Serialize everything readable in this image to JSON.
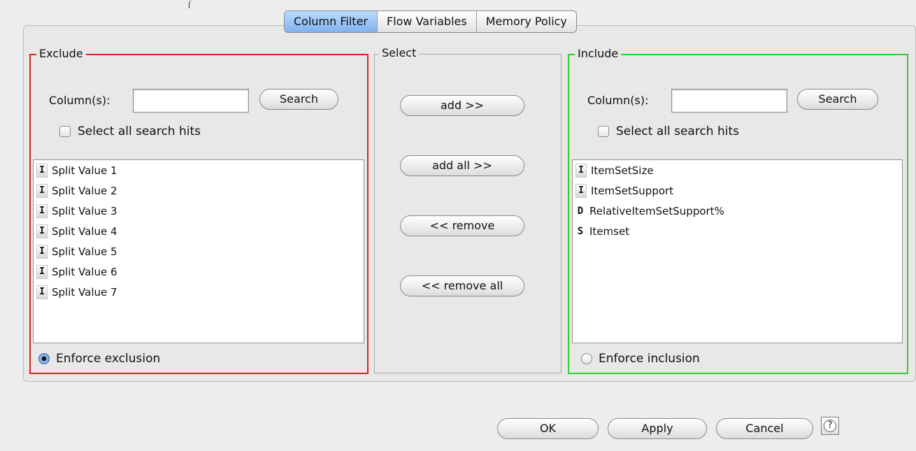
{
  "tabs": [
    {
      "label": "Column Filter",
      "active": true
    },
    {
      "label": "Flow Variables",
      "active": false
    },
    {
      "label": "Memory Policy",
      "active": false
    }
  ],
  "exclude": {
    "title": "Exclude",
    "columns_label": "Column(s):",
    "search_value": "",
    "search_button": "Search",
    "select_all_label": "Select all search hits",
    "select_all_checked": false,
    "items": [
      {
        "type": "I",
        "label": "Split Value 1"
      },
      {
        "type": "I",
        "label": "Split Value 2"
      },
      {
        "type": "I",
        "label": "Split Value 3"
      },
      {
        "type": "I",
        "label": "Split Value 4"
      },
      {
        "type": "I",
        "label": "Split Value 5"
      },
      {
        "type": "I",
        "label": "Split Value 6"
      },
      {
        "type": "I",
        "label": "Split Value 7"
      }
    ],
    "enforce_label": "Enforce exclusion",
    "enforce_selected": true,
    "border_color": "#e02020"
  },
  "select": {
    "title": "Select",
    "add": "add >>",
    "add_all": "add all >>",
    "remove": "<< remove",
    "remove_all": "<< remove all"
  },
  "include": {
    "title": "Include",
    "columns_label": "Column(s):",
    "search_value": "",
    "search_button": "Search",
    "select_all_label": "Select all search hits",
    "select_all_checked": false,
    "items": [
      {
        "type": "I",
        "label": "ItemSetSize"
      },
      {
        "type": "I",
        "label": "ItemSetSupport"
      },
      {
        "type": "D",
        "label": "RelativeItemSetSupport%"
      },
      {
        "type": "S",
        "label": "Itemset"
      }
    ],
    "enforce_label": "Enforce inclusion",
    "enforce_selected": false,
    "border_color": "#2ed02e"
  },
  "footer": {
    "ok": "OK",
    "apply": "Apply",
    "cancel": "Cancel",
    "help": "?"
  },
  "icons": {
    "int_type": "integer-column-icon",
    "double_type": "double-column-icon",
    "string_type": "string-column-icon",
    "help": "help-icon"
  },
  "colors": {
    "active_tab": "#7fb2ee",
    "exclude_border": "#e02020",
    "include_border": "#2ed02e"
  }
}
